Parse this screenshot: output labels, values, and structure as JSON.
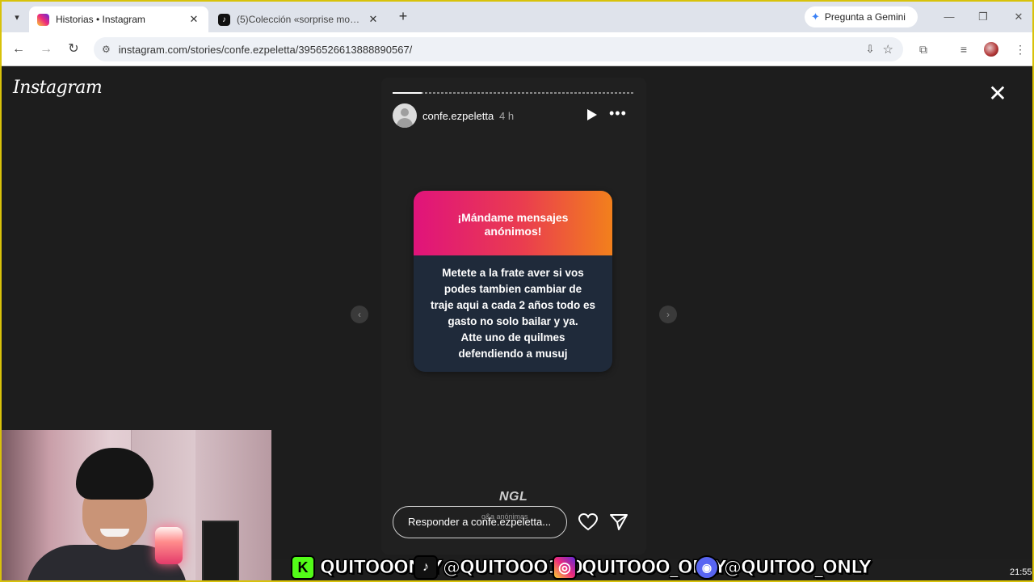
{
  "browser": {
    "tabs": [
      {
        "title": "Historias • Instagram",
        "active": true,
        "favicon": "instagram-icon"
      },
      {
        "title": "(5)Colección «sorprise moments»",
        "active": false,
        "favicon": "tiktok-icon"
      }
    ],
    "gemini_label": "Pregunta a Gemini",
    "url": "instagram.com/stories/confe.ezpeletta/3956526613888890567/"
  },
  "page": {
    "logo": "Instagram",
    "story": {
      "username": "confe.ezpeletta",
      "time_ago": "4 h",
      "progress": 0.12,
      "card": {
        "title_lines": [
          "¡Mándame mensajes",
          "anónimos!"
        ],
        "body_lines": [
          "Metete a la frate aver si vos",
          "podes tambien cambiar de",
          "traje aqui a cada 2 años todo es",
          "gasto no solo bailar y ya.",
          "Atte uno de quilmes",
          "defendiendo a musuj"
        ],
        "colors": {
          "gradient_start": "#e0137b",
          "gradient_end": "#f2801c",
          "body_bg": "#1f2a3a"
        }
      },
      "watermark": "NGL",
      "watermark_sub": "q&a anónimas",
      "reply_placeholder": "Responder a confe.ezpeletta..."
    }
  },
  "banner": {
    "kick": "QUITOOONLY",
    "tiktok": "@QUITOOO120",
    "instagram": "QUITOOO_ONLY",
    "discord": "@QUITOO_ONLY"
  },
  "clock": "21:55"
}
